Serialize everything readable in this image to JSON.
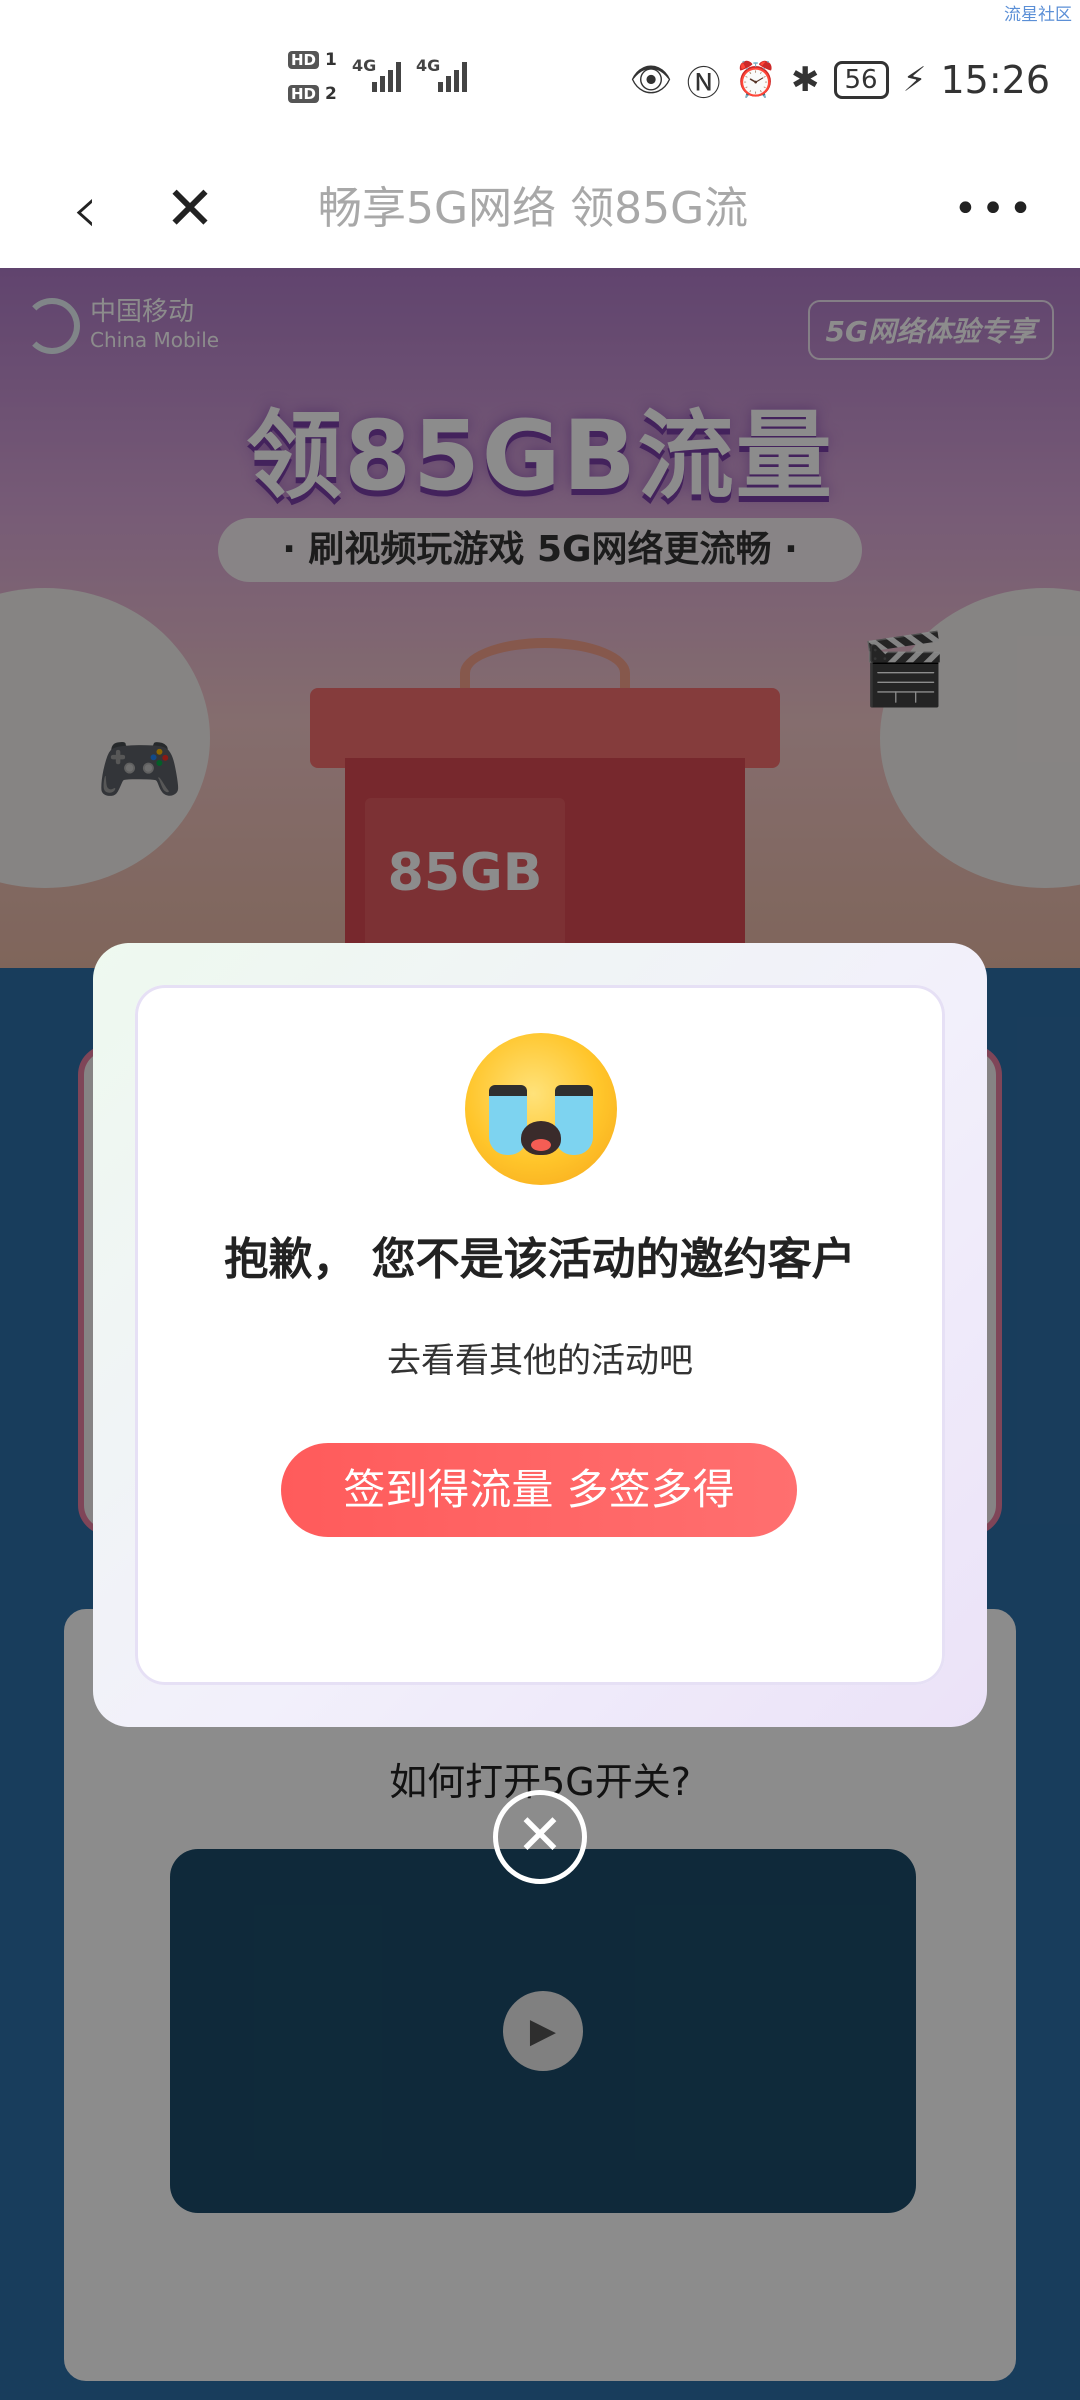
{
  "status_bar": {
    "watermark": "流星社区",
    "sim1_label": "HD",
    "sim1_index": "1",
    "sim2_label": "HD",
    "sim2_index": "2",
    "net1": "4G",
    "net2": "4G",
    "battery": "56",
    "time": "15:26",
    "icons": [
      "eye-icon",
      "nfc-icon",
      "alarm-icon",
      "bluetooth-icon",
      "battery-icon",
      "charging-icon"
    ]
  },
  "nav": {
    "back_icon": "chevron-left-icon",
    "close_icon": "close-icon",
    "title": "畅享5G网络 领85G流",
    "more_icon": "more-icon"
  },
  "banner": {
    "logo_cn": "中国移动",
    "logo_en": "China Mobile",
    "tag": "5G网络体验专享",
    "headline": "领85GB流量",
    "subline": "· 刷视频玩游戏 5G网络更流畅 ·",
    "gift_label": "85GB"
  },
  "content": {
    "howto_title": "如何打开5G开关?"
  },
  "modal": {
    "title": "抱歉， 您不是该活动的邀约客户",
    "subtitle": "去看看其他的活动吧",
    "button_label": "签到得流量 多签多得",
    "close_icon": "close-circle-icon",
    "accent": "#ff5b5b"
  }
}
